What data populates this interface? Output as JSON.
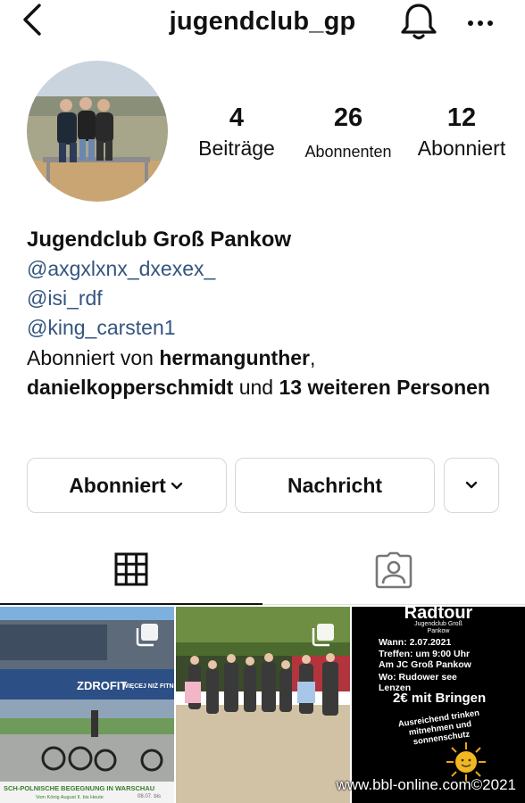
{
  "header": {
    "username": "jugendclub_gp",
    "back_icon": "chevron-left-icon",
    "bell_icon": "bell-icon",
    "more_icon": "more-horizontal-icon"
  },
  "stats": {
    "posts": {
      "value": "4",
      "label": "Beiträge"
    },
    "followers": {
      "value": "26",
      "label": "Abonnenten"
    },
    "following": {
      "value": "12",
      "label": "Abonniert"
    }
  },
  "bio": {
    "name": "Jugendclub Groß Pankow",
    "mentions": [
      "@axgxlxnx_dxexex_",
      "@isi_rdf",
      "@king_carsten1"
    ],
    "followed_prefix": "Abonniert von ",
    "followed_user1": "hermangunther",
    "followed_sep": ",",
    "followed_user2": "danielkopperschmidt",
    "followed_and": " und ",
    "followed_more": "13 weiteren Personen"
  },
  "actions": {
    "following_label": "Abonniert",
    "message_label": "Nachricht",
    "more_icon": "chevron-down-icon"
  },
  "tabs": {
    "grid_icon": "grid-icon",
    "tagged_icon": "tagged-person-icon"
  },
  "posts": {
    "post1": {
      "sign": "ZDROFIT",
      "sign2": "WIĘCEJ NIŻ FITNESS",
      "caption": "SCH-POLNISCHE BEGEGNUNG IN WARSCHAU",
      "caption2": "Vom König August II. bis Heute",
      "caption3": "08.07. bis"
    },
    "post3": {
      "title": "Radtour",
      "subtitle1": "Jugendclub Groß",
      "subtitle2": "Pankow",
      "line1": "Wann: 2.07.2021",
      "line2": "Treffen: um 9:00 Uhr",
      "line3": "Am JC Groß Pankow",
      "line4": "Wo: Rudower see",
      "line5": "Lenzen",
      "price": "2€ mit Bringen",
      "note": "Ausreichend trinken mitnehmen und sonnenschutz"
    }
  },
  "watermark": "www.bbl-online.com©2021",
  "colors": {
    "link": "#33557f",
    "border": "#d6d6d6"
  }
}
